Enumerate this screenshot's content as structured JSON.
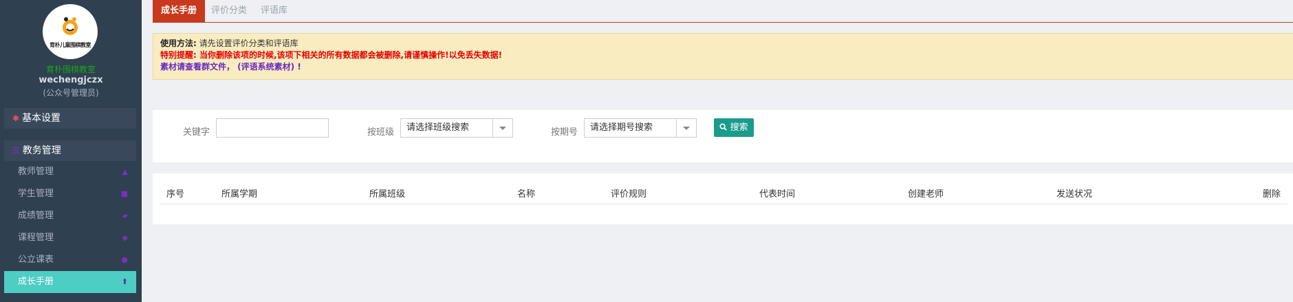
{
  "sidebar": {
    "logo_text": "育朴儿童围棋教室",
    "school_name": "育朴围棋教室",
    "username": "wechengjczx",
    "role": "(公众号管理员)",
    "menu": [
      {
        "label": "基本设置",
        "icon": "gear-icon"
      },
      {
        "label": "教务管理",
        "icon": "list-icon"
      }
    ],
    "items": [
      {
        "label": "教师管理",
        "icon": "user-icon"
      },
      {
        "label": "学生管理",
        "icon": "users-icon"
      },
      {
        "label": "成绩管理",
        "icon": "chart-icon"
      },
      {
        "label": "课程管理",
        "icon": "graduation-cap-icon"
      },
      {
        "label": "公立课表",
        "icon": "circle-icon"
      },
      {
        "label": "成长手册",
        "icon": "arrow-up-icon"
      }
    ]
  },
  "tabs": [
    "成长手册",
    "评价分类",
    "评语库"
  ],
  "notice": {
    "l1_bold": "使用方法:",
    "l1_text": " 请先设置评价分类和评语库",
    "l2": "特别提醒: 当你删除该项的时候,该项下相关的所有数据都会被删除,请谨慎操作!以免丢失数据!",
    "l3": "素材请查看群文件， (评语系统素材) !"
  },
  "search": {
    "keyword_label": "关键字",
    "class_label": "按班级",
    "class_select": "请选择班级搜索",
    "period_label": "按期号",
    "period_select": "请选择期号搜索",
    "button": "搜索"
  },
  "table": {
    "columns": [
      "序号",
      "所属学期",
      "所属班级",
      "名称",
      "评价规则",
      "代表时间",
      "创建老师",
      "发送状况",
      "删除"
    ]
  },
  "colors": {
    "sidebar_bg": "#2f4050",
    "active_item": "#4ecdc4",
    "tab_active": "#c8391d",
    "search_button": "#1a9c8c",
    "warning_text": "#e60000"
  }
}
